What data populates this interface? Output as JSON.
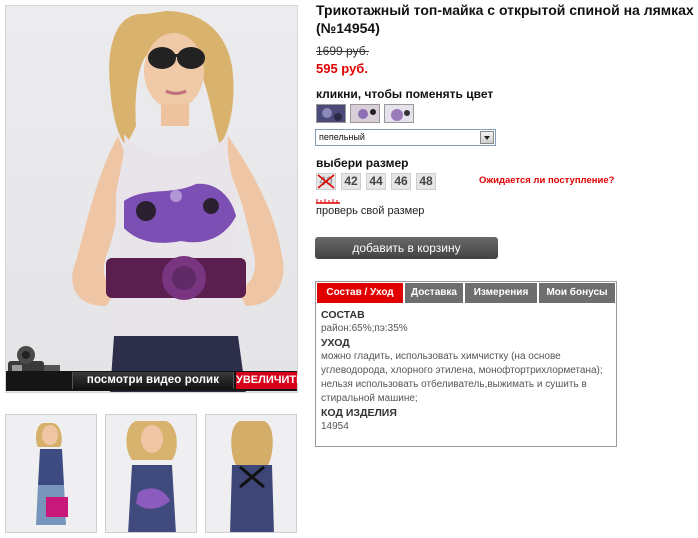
{
  "product": {
    "title": "Трикотажный топ-майка с открытой спиной на лямках (№14954)",
    "old_price": "1699 руб.",
    "new_price": "595 руб."
  },
  "colors": {
    "label": "кликни, чтобы поменять цвет",
    "selected": "пепельный",
    "swatch_colors": [
      "#4b4a78",
      "#d9cfd9",
      "#9a7ab8"
    ]
  },
  "sizes": {
    "label": "выбери размер",
    "items": [
      {
        "label": "40",
        "available": false
      },
      {
        "label": "42",
        "available": true
      },
      {
        "label": "44",
        "available": true
      },
      {
        "label": "46",
        "available": true
      },
      {
        "label": "48",
        "available": true
      }
    ],
    "waiting_link": "Ожидается ли поступление?",
    "check_size": "проверь свой размер"
  },
  "cart": {
    "button": "добавить в корзину"
  },
  "media": {
    "video_label": "посмотри видео ролик",
    "zoom_label": "УВЕЛИЧИТЬ"
  },
  "tabs": [
    {
      "label": "Состав / Уход",
      "active": true
    },
    {
      "label": "Доставка",
      "active": false
    },
    {
      "label": "Измерения",
      "active": false
    },
    {
      "label": "Мои бонусы",
      "active": false
    }
  ],
  "details": {
    "composition_heading": "СОСТАВ",
    "composition": "район:65%;пэ:35%",
    "care_heading": "УХОД",
    "care": "можно гладить, использовать химчистку (на основе углеводорода, хлорного этилена, монофтортрихлорметана); нельзя использовать отбеливатель,выжимать и сушить в стиральной машине;",
    "code_heading": "КОД ИЗДЕЛИЯ",
    "code": "14954"
  },
  "accent_color": "#e00000"
}
